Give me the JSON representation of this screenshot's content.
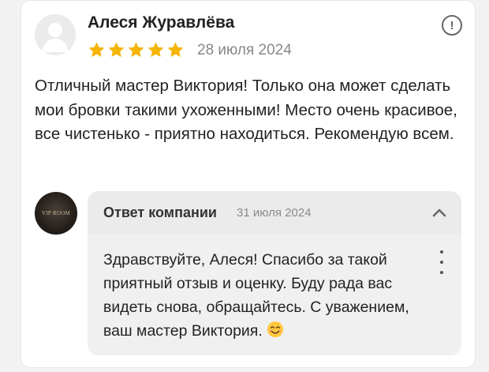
{
  "review": {
    "author": "Алеся Журавлёва",
    "rating": 5,
    "date": "28 июля 2024",
    "text": "Отличный мастер Виктория! Только она может сделать мои бровки такими ухоженными! Место очень красивое, все чистенько - приятно находиться. Рекомендую всем.",
    "report_icon": "exclamation-circle-icon",
    "report_label": "!"
  },
  "reply": {
    "company_logo_text": "VIP ROOM",
    "title": "Ответ компании",
    "date": "31 июля 2024",
    "text": "Здравствуйте, Алеся! Спасибо за такой приятный отзыв и оценку. Буду рада вас видеть снова, обращайтесь. С уважением, ваш мастер Виктория.",
    "emoji_icon": "smiling-face-icon"
  },
  "colors": {
    "star": "#f5b400",
    "card_bg": "#ffffff",
    "reply_bg": "#f0f0f0"
  }
}
